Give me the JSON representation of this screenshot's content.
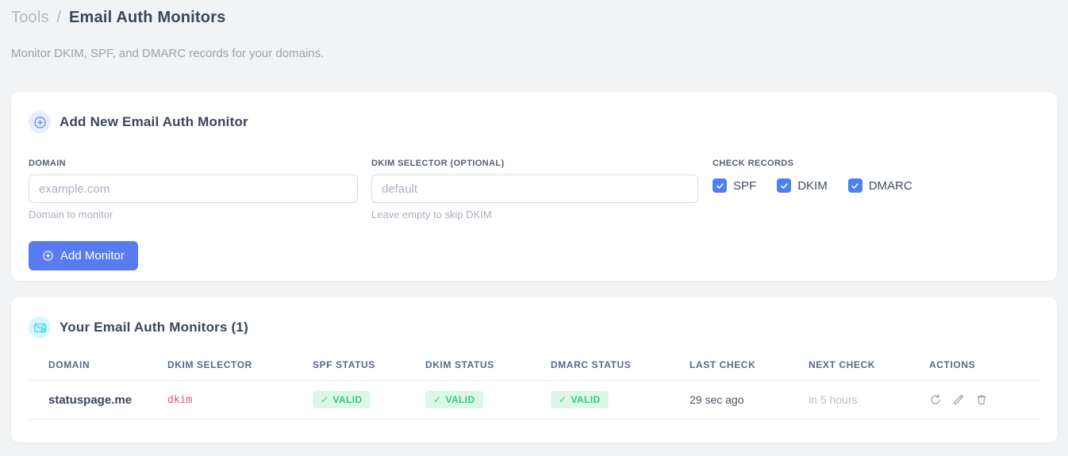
{
  "header": {
    "breadcrumb_section": "Tools",
    "breadcrumb_separator": "/",
    "title": "Email Auth Monitors",
    "subtitle": "Monitor DKIM, SPF, and DMARC records for your domains."
  },
  "add_card": {
    "title": "Add New Email Auth Monitor",
    "header_icon": "plus-circle-icon",
    "domain_field": {
      "label": "DOMAIN",
      "value": "",
      "placeholder": "example.com",
      "hint": "Domain to monitor"
    },
    "selector_field": {
      "label": "DKIM SELECTOR (OPTIONAL)",
      "value": "",
      "placeholder": "default",
      "hint": "Leave empty to skip DKIM"
    },
    "check_records": {
      "label": "CHECK RECORDS",
      "options": [
        {
          "label": "SPF",
          "checked": true
        },
        {
          "label": "DKIM",
          "checked": true
        },
        {
          "label": "DMARC",
          "checked": true
        }
      ]
    },
    "submit_label": "Add Monitor"
  },
  "monitors_card": {
    "title": "Your Email Auth Monitors (1)",
    "header_icon": "envelope-check-icon",
    "count": 1,
    "columns": [
      "DOMAIN",
      "DKIM SELECTOR",
      "SPF STATUS",
      "DKIM STATUS",
      "DMARC STATUS",
      "LAST CHECK",
      "NEXT CHECK",
      "ACTIONS"
    ],
    "rows": [
      {
        "domain": "statuspage.me",
        "dkim_selector": "dkim",
        "spf_status": "VALID",
        "dkim_status": "VALID",
        "dmarc_status": "VALID",
        "last_check": "29 sec ago",
        "next_check": "in 5 hours",
        "actions": [
          "refresh-icon",
          "edit-icon",
          "delete-icon"
        ]
      }
    ]
  },
  "icons": {
    "check_glyph": "✓"
  },
  "colors": {
    "accent_blue": "#587cf0",
    "accent_cyan": "#2bd4e7",
    "valid_green": "#2fcb82",
    "valid_green_bg": "#dcf7ea",
    "code_pink": "#ea4c8b",
    "page_bg": "#f2f3f5"
  }
}
